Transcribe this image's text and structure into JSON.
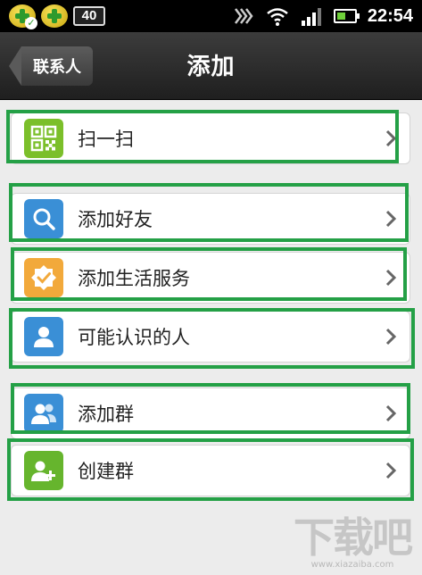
{
  "status_bar": {
    "battery_badge": "40",
    "time": "22:54",
    "icons": [
      "security-shield-icon",
      "security-cross-icon",
      "battery-level-icon",
      "signal-buzz-icon",
      "wifi-icon",
      "cell-signal-icon",
      "battery-icon"
    ]
  },
  "header": {
    "back_label": "联系人",
    "title": "添加"
  },
  "menu": {
    "items": [
      {
        "label": "扫一扫",
        "icon": "qr-code-icon",
        "color": "#7bbf2a"
      },
      {
        "label": "添加好友",
        "icon": "search-icon",
        "color": "#3a8fd6"
      },
      {
        "label": "添加生活服务",
        "icon": "verified-badge-icon",
        "color": "#f2a93b"
      },
      {
        "label": "可能认识的人",
        "icon": "person-icon",
        "color": "#3a8fd6"
      },
      {
        "label": "添加群",
        "icon": "group-icon",
        "color": "#3a8fd6"
      },
      {
        "label": "创建群",
        "icon": "add-group-icon",
        "color": "#66b52d"
      }
    ]
  },
  "watermark": {
    "logo": "下载吧",
    "url": "www.xiazaiba.com"
  },
  "colors": {
    "highlight": "#24a046",
    "title_bar": "#2b2b2b",
    "background": "#ececec"
  }
}
